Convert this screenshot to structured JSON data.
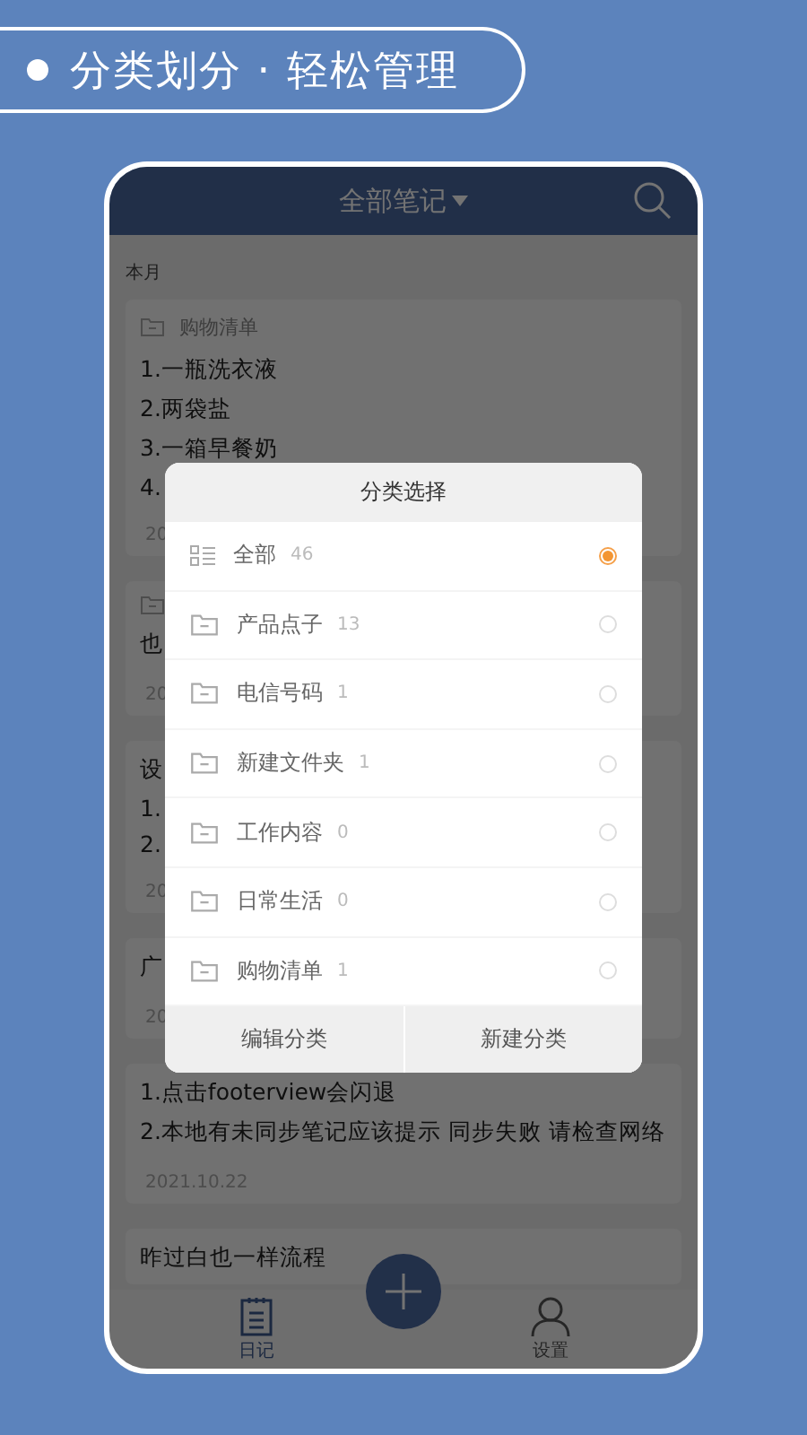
{
  "banner": {
    "text": "分类划分 · 轻松管理"
  },
  "header": {
    "title": "全部笔记"
  },
  "section": "本月",
  "notes": [
    {
      "folder": true,
      "category": "购物清单",
      "lines": [
        "1.一瓶洗衣液",
        "2.两袋盐",
        "3.一箱早餐奶",
        "4."
      ],
      "date": "20"
    },
    {
      "folder": true,
      "lines": [
        "也"
      ],
      "date": "20"
    },
    {
      "folder": false,
      "lines": [
        "设",
        "1.",
        "2."
      ],
      "date": "20"
    },
    {
      "folder": false,
      "lines": [
        "广"
      ],
      "date": "20"
    },
    {
      "folder": false,
      "lines": [
        "1.点击footerview会闪退",
        "2.本地有未同步笔记应该提示 同步失败 请检查网络"
      ],
      "date": "2021.10.22"
    },
    {
      "folder": false,
      "lines": [
        "昨过白也一样流程"
      ]
    }
  ],
  "dialog": {
    "title": "分类选择",
    "categories": [
      {
        "kind": "all",
        "name": "全部",
        "count": "46",
        "selected": true
      },
      {
        "kind": "folder",
        "name": "产品点子",
        "count": "13",
        "selected": false
      },
      {
        "kind": "folder",
        "name": "电信号码",
        "count": "1",
        "selected": false
      },
      {
        "kind": "folder",
        "name": "新建文件夹",
        "count": "1",
        "selected": false
      },
      {
        "kind": "folder",
        "name": "工作内容",
        "count": "0",
        "selected": false
      },
      {
        "kind": "folder",
        "name": "日常生活",
        "count": "0",
        "selected": false
      },
      {
        "kind": "folder",
        "name": "购物清单",
        "count": "1",
        "selected": false
      }
    ],
    "buttons": [
      "编辑分类",
      "新建分类"
    ]
  },
  "nav": [
    {
      "label": "日记",
      "kind": "diary",
      "selected": true
    },
    {
      "label": "设置",
      "kind": "profile",
      "selected": false
    }
  ]
}
